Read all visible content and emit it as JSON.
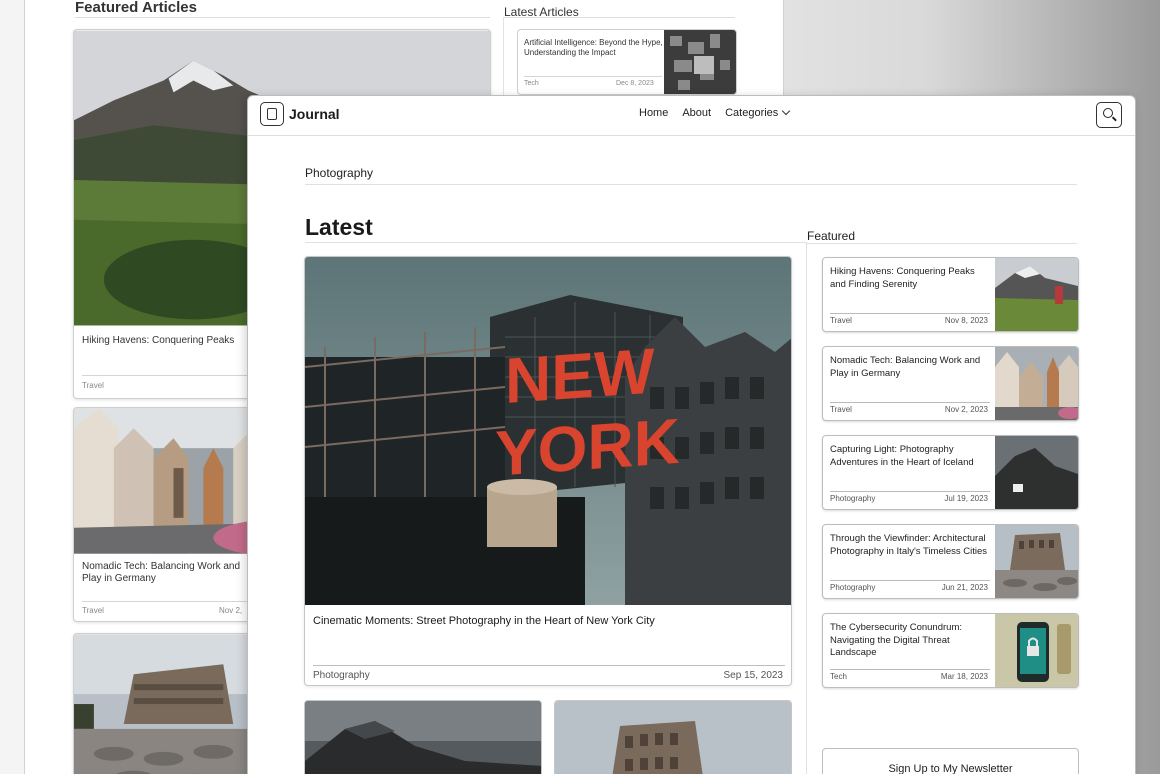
{
  "background_page": {
    "featured_heading": "Featured Articles",
    "latest_heading": "Latest Articles",
    "cards": [
      {
        "title": "Hiking Havens: Conquering Peaks",
        "category": "Travel",
        "date": ""
      },
      {
        "title": "Nomadic Tech: Balancing Work and Play in Germany",
        "category": "Travel",
        "date": "Nov 2,"
      },
      {
        "title": "",
        "category": "",
        "date": ""
      }
    ],
    "latest_item": {
      "title": "Artificial Intelligence: Beyond the Hype, Understanding the Impact",
      "category": "Tech",
      "date": "Dec 8, 2023"
    }
  },
  "nav": {
    "logo": "Journal",
    "links": [
      "Home",
      "About",
      "Categories"
    ],
    "icons": {
      "logo": "journal-logo-icon",
      "search": "search-icon",
      "dropdown": "chevron-down-icon"
    }
  },
  "breadcrumb": "Photography",
  "latest": {
    "heading": "Latest",
    "hero": {
      "title": "Cinematic Moments: Street Photography in the Heart of New York City",
      "category": "Photography",
      "date": "Sep 15, 2023",
      "sign_text": [
        "NEW",
        "YORK"
      ]
    }
  },
  "featured": {
    "heading": "Featured",
    "items": [
      {
        "title": "Hiking Havens: Conquering Peaks and Finding Serenity",
        "category": "Travel",
        "date": "Nov 8, 2023"
      },
      {
        "title": "Nomadic Tech: Balancing Work and Play in Germany",
        "category": "Travel",
        "date": "Nov 2, 2023"
      },
      {
        "title": "Capturing Light: Photography Adventures in the Heart of Iceland",
        "category": "Photography",
        "date": "Jul 19, 2023"
      },
      {
        "title": "Through the Viewfinder: Architectural Photography in Italy's Timeless Cities",
        "category": "Photography",
        "date": "Jun 21, 2023"
      },
      {
        "title": "The Cybersecurity Conundrum: Navigating the Digital Threat Landscape",
        "category": "Tech",
        "date": "Mar 18, 2023"
      }
    ]
  },
  "newsletter": {
    "label": "Sign Up to My Newsletter"
  },
  "colors": {
    "accent_sign": "#d9442f",
    "border": "#bdbdbd",
    "text": "#1a1a1a"
  }
}
